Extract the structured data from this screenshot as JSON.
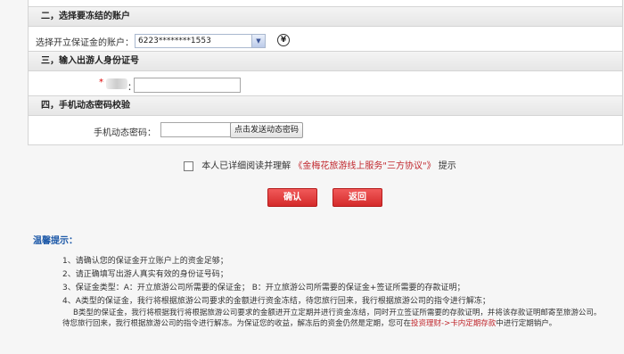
{
  "sections": {
    "account": "二，选择要冻结的账户",
    "id_number": "三，输入出游人身份证号",
    "sms": "四，手机动态密码校验"
  },
  "account": {
    "label": "选择开立保证金的账户：",
    "selected": "6223********1553"
  },
  "id_number": {
    "required_mark": "*",
    "label_suffix": "："
  },
  "sms": {
    "label": "手机动态密码：",
    "send_button": "点击发送动态密码"
  },
  "agreement": {
    "prefix": "本人已详细阅读并理解",
    "link": "《金梅花旅游线上服务\"三方协议\"》",
    "suffix": "提示"
  },
  "buttons": {
    "confirm": "确认",
    "back": "返回"
  },
  "tips": {
    "title": "温馨提示：",
    "line1": "1、请确认您的保证金开立账户上的资金足够；",
    "line2": "2、请正确填写出游人真实有效的身份证号码；",
    "line3": "3、保证金类型：A：开立旅游公司所需要的保证金； B：开立旅游公司所需要的保证金+签证所需要的存款证明；",
    "line4": "4、A类型的保证金，我行将根据旅游公司要求的金额进行资金冻结，待您旅行回来，我行根据旅游公司的指令进行解冻；",
    "line5": "B类型的保证金，我行将根据我行将根据旅游公司要求的金额进开立定期并进行资金冻结，同时开立签证所需要的存款证明，并将该存款证明邮寄至旅游公司。",
    "line6_prefix": "待您旅行回来，我行根据旅游公司的指令进行解冻。为保证您的收益，解冻后的资金仍然是定期，您可在",
    "line6_link": "投资理财->卡内定期存款",
    "line6_suffix": "中进行定期销户。"
  }
}
